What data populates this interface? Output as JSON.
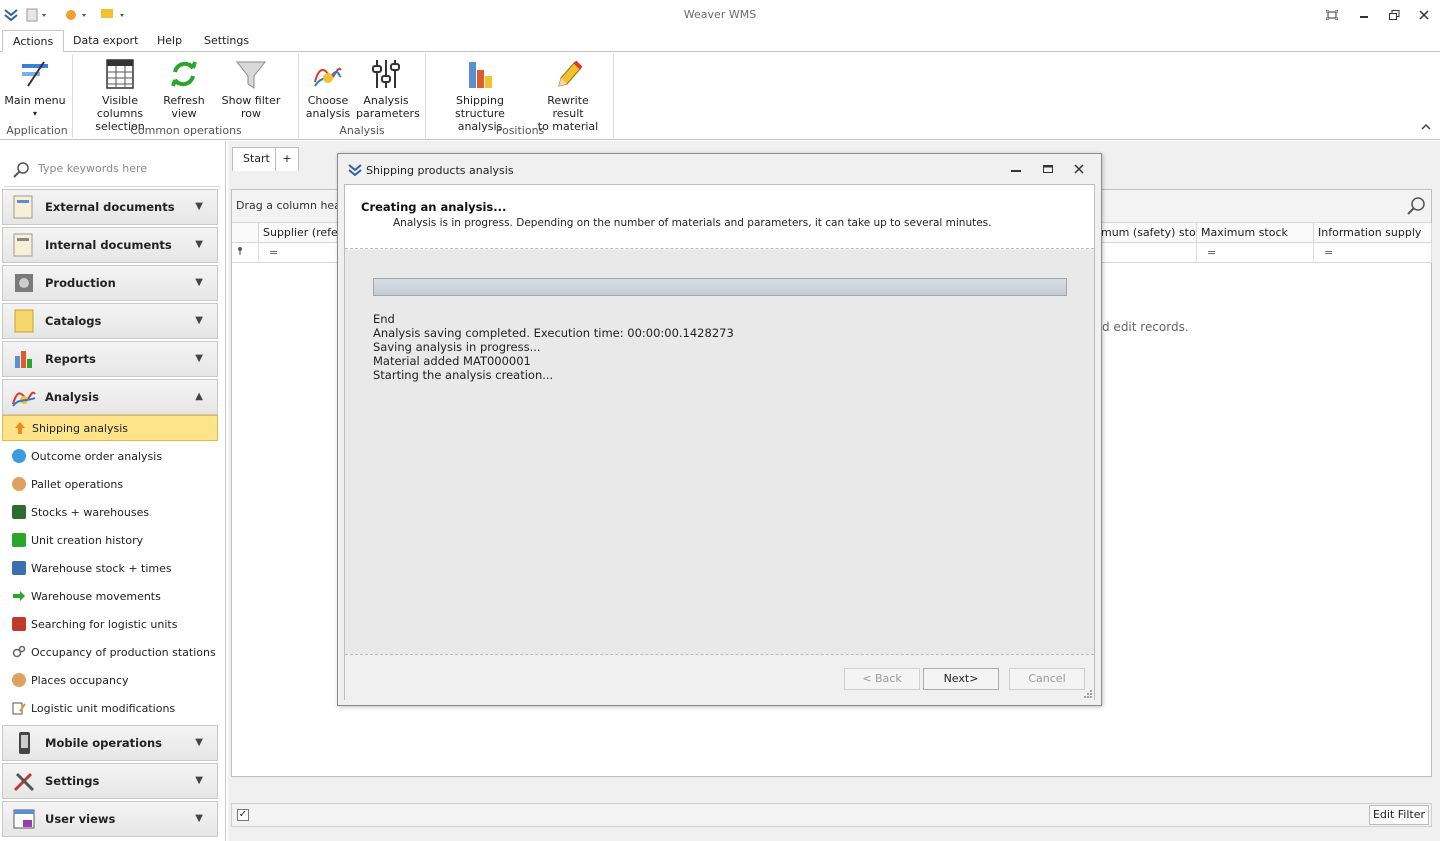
{
  "window": {
    "title": "Weaver WMS"
  },
  "ribbon_tabs": [
    "Actions",
    "Data export",
    "Help",
    "Settings"
  ],
  "ribbon": {
    "buttons": [
      {
        "label1": "Main menu",
        "label2": "▾"
      },
      {
        "label1": "Visible columns",
        "label2": "selection"
      },
      {
        "label1": "Refresh",
        "label2": "view"
      },
      {
        "label1": "Show filter row",
        "label2": ""
      },
      {
        "label1": "Choose",
        "label2": "analysis"
      },
      {
        "label1": "Analysis",
        "label2": "parameters"
      },
      {
        "label1": "Shipping structure",
        "label2": "analysis"
      },
      {
        "label1": "Rewrite result",
        "label2": "to material"
      }
    ],
    "groups": [
      "Application",
      "Common operations",
      "Analysis",
      "Positions"
    ]
  },
  "nav": {
    "search_placeholder": "Type keywords here",
    "groups": [
      {
        "label": "External documents"
      },
      {
        "label": "Internal documents"
      },
      {
        "label": "Production"
      },
      {
        "label": "Catalogs"
      },
      {
        "label": "Reports"
      },
      {
        "label": "Analysis"
      },
      {
        "label": "Mobile operations"
      },
      {
        "label": "Settings"
      },
      {
        "label": "User views"
      }
    ],
    "analysis_items": [
      "Shipping analysis",
      "Outcome order analysis",
      "Pallet operations",
      "Stocks + warehouses",
      "Unit creation history",
      "Warehouse stock + times",
      "Warehouse movements",
      "Searching for logistic units",
      "Occupancy of production stations",
      "Places occupancy",
      "Logistic unit modifications"
    ]
  },
  "main": {
    "doc_tabs": [
      "Start",
      "+"
    ],
    "group_panel_text": "Drag a column heade",
    "columns": [
      "Supplier (refere",
      "mum (safety) sto...",
      "Maximum stock",
      "Information supply"
    ],
    "filter_symbol": "=",
    "empty_text": "d  edit records.",
    "edit_filter": "Edit Filter"
  },
  "dialog": {
    "title": "Shipping products analysis",
    "heading": "Creating an analysis...",
    "description": "Analysis is in progress. Depending on the number of materials and parameters, it can take up to several minutes.",
    "log": [
      "End",
      "Analysis saving completed. Execution time: 00:00:00.1428273",
      "Saving analysis in progress...",
      "Material added MAT000001",
      "Starting the analysis creation..."
    ],
    "buttons": {
      "back": "< Back",
      "next": "Next>",
      "cancel": "Cancel"
    }
  }
}
